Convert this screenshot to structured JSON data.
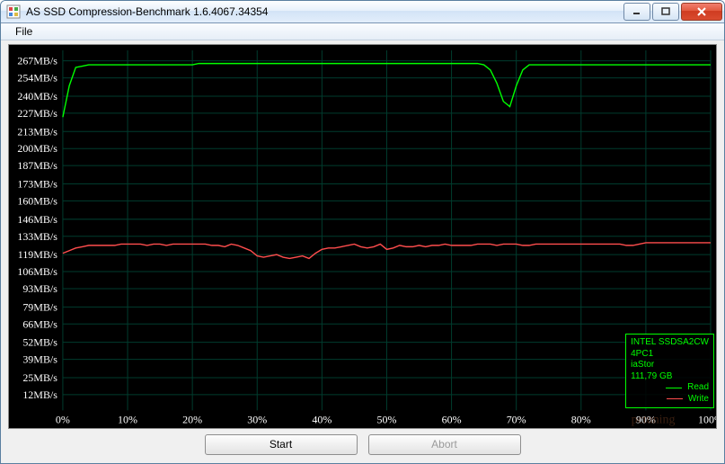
{
  "window": {
    "title": "AS SSD Compression-Benchmark 1.6.4067.34354"
  },
  "menubar": {
    "file": "File"
  },
  "buttons": {
    "start": "Start",
    "abort": "Abort"
  },
  "legend": {
    "device": "INTEL SSDSA2CW",
    "line2": "4PC1",
    "driver": "iaStor",
    "capacity": "111,79 GB",
    "read_label": "Read",
    "write_label": "Write",
    "read_color": "#00ff00",
    "write_color": "#ff4d4d"
  },
  "watermark": "pctuning",
  "chart_data": {
    "type": "line",
    "xlabel": "",
    "ylabel": "",
    "title": "",
    "x_unit": "%",
    "y_unit": "MB/s",
    "xlim": [
      0,
      100
    ],
    "ylim": [
      0,
      275
    ],
    "x_ticks": [
      0,
      10,
      20,
      30,
      40,
      50,
      60,
      70,
      80,
      90,
      100
    ],
    "y_ticks": [
      12,
      25,
      39,
      52,
      66,
      79,
      93,
      106,
      119,
      133,
      146,
      160,
      173,
      187,
      200,
      213,
      227,
      240,
      254,
      267
    ],
    "x": [
      0,
      1,
      2,
      3,
      4,
      5,
      6,
      7,
      8,
      9,
      10,
      11,
      12,
      13,
      14,
      15,
      16,
      17,
      18,
      19,
      20,
      21,
      22,
      23,
      24,
      25,
      26,
      27,
      28,
      29,
      30,
      31,
      32,
      33,
      34,
      35,
      36,
      37,
      38,
      39,
      40,
      41,
      42,
      43,
      44,
      45,
      46,
      47,
      48,
      49,
      50,
      51,
      52,
      53,
      54,
      55,
      56,
      57,
      58,
      59,
      60,
      61,
      62,
      63,
      64,
      65,
      66,
      67,
      68,
      69,
      70,
      71,
      72,
      73,
      74,
      75,
      76,
      77,
      78,
      79,
      80,
      81,
      82,
      83,
      84,
      85,
      86,
      87,
      88,
      89,
      90,
      91,
      92,
      93,
      94,
      95,
      96,
      97,
      98,
      99,
      100
    ],
    "series": [
      {
        "name": "Read",
        "color": "#00ff00",
        "values": [
          224,
          248,
          262,
          263,
          264,
          264,
          264,
          264,
          264,
          264,
          264,
          264,
          264,
          264,
          264,
          264,
          264,
          264,
          264,
          264,
          264,
          265,
          265,
          265,
          265,
          265,
          265,
          265,
          265,
          265,
          265,
          265,
          265,
          265,
          265,
          265,
          265,
          265,
          265,
          265,
          265,
          265,
          265,
          265,
          265,
          265,
          265,
          265,
          265,
          265,
          265,
          265,
          265,
          265,
          265,
          265,
          265,
          265,
          265,
          265,
          265,
          265,
          265,
          265,
          265,
          264,
          260,
          250,
          236,
          232,
          248,
          260,
          264,
          264,
          264,
          264,
          264,
          264,
          264,
          264,
          264,
          264,
          264,
          264,
          264,
          264,
          264,
          264,
          264,
          264,
          264,
          264,
          264,
          264,
          264,
          264,
          264,
          264,
          264,
          264,
          264
        ]
      },
      {
        "name": "Write",
        "color": "#ff4d4d",
        "values": [
          120,
          122,
          124,
          125,
          126,
          126,
          126,
          126,
          126,
          127,
          127,
          127,
          127,
          126,
          127,
          127,
          126,
          127,
          127,
          127,
          127,
          127,
          127,
          126,
          126,
          125,
          127,
          126,
          124,
          122,
          118,
          117,
          118,
          119,
          117,
          116,
          117,
          118,
          116,
          120,
          123,
          124,
          124,
          125,
          126,
          127,
          125,
          124,
          125,
          127,
          123,
          124,
          126,
          125,
          125,
          126,
          125,
          126,
          126,
          127,
          126,
          126,
          126,
          126,
          127,
          127,
          127,
          126,
          127,
          127,
          127,
          126,
          126,
          127,
          127,
          127,
          127,
          127,
          127,
          127,
          127,
          127,
          127,
          127,
          127,
          127,
          127,
          126,
          126,
          127,
          128,
          128,
          128,
          128,
          128,
          128,
          128,
          128,
          128,
          128,
          128
        ]
      }
    ]
  }
}
